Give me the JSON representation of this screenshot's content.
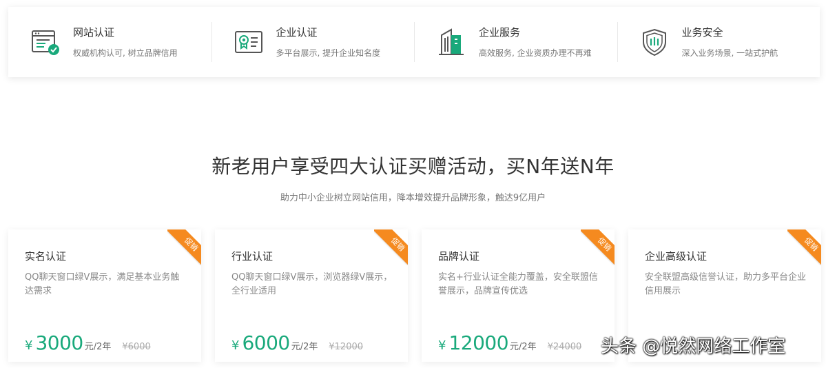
{
  "features": [
    {
      "icon": "website-cert-icon",
      "title": "网站认证",
      "desc": "权威机构认可, 树立品牌信用"
    },
    {
      "icon": "enterprise-cert-icon",
      "title": "企业认证",
      "desc": "多平台展示, 提升企业知名度"
    },
    {
      "icon": "enterprise-service-icon",
      "title": "企业服务",
      "desc": "高效服务, 企业资质办理不再难"
    },
    {
      "icon": "business-security-icon",
      "title": "业务安全",
      "desc": "深入业务场景, 一站式护航"
    }
  ],
  "promo": {
    "title": "新老用户享受四大认证买赠活动，买N年送N年",
    "subtitle": "助力中小企业树立网站信用，降本增效提升品牌形象，触达9亿用户"
  },
  "cards": [
    {
      "title": "实名认证",
      "desc": "QQ聊天窗口绿V展示，满足基本业务触达需求",
      "symbol": "¥",
      "price": "3000",
      "unit": "元/2年",
      "old": "¥6000",
      "ribbon": "促销"
    },
    {
      "title": "行业认证",
      "desc": "QQ聊天窗口绿V展示，浏览器绿V展示，全行业适用",
      "symbol": "¥",
      "price": "6000",
      "unit": "元/2年",
      "old": "¥12000",
      "ribbon": "促销"
    },
    {
      "title": "品牌认证",
      "desc": "实名+行业认证全能力覆盖，安全联盟信誉展示，品牌宣传优选",
      "symbol": "¥",
      "price": "12000",
      "unit": "元/2年",
      "old": "¥24000",
      "ribbon": "促销"
    },
    {
      "title": "企业高级认证",
      "desc": "安全联盟高级信誉认证，助力多平台企业信用展示",
      "symbol": "",
      "price": "",
      "unit": "",
      "old": "",
      "ribbon": "促销"
    }
  ],
  "watermark": "头条 @悦然网络工作室",
  "colors": {
    "accent": "#19a97b",
    "ribbon": "#f58a1f",
    "icon_dark": "#555555"
  }
}
